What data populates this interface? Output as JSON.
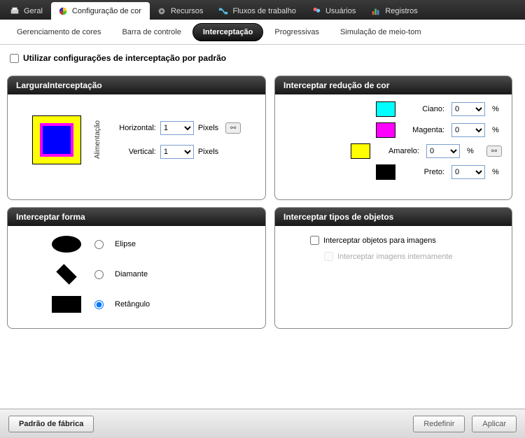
{
  "tabs": {
    "general": "Geral",
    "color": "Configuração de cor",
    "resources": "Recursos",
    "workflows": "Fluxos de trabalho",
    "users": "Usuários",
    "logs": "Registros",
    "active": "color"
  },
  "subtabs": {
    "items": [
      "Gerenciamento de cores",
      "Barra de controle",
      "Interceptação",
      "Progressivas",
      "Simulação de meio-tom"
    ],
    "active_index": 2
  },
  "checkbox_default": {
    "label": "Utilizar configurações de interceptação por padrão",
    "checked": false
  },
  "trap_width": {
    "title": "LarguraInterceptação",
    "feed_label": "Alimentação",
    "horizontal_label": "Horizontal:",
    "vertical_label": "Vertical:",
    "unit": "Pixels",
    "horizontal_value": "1",
    "vertical_value": "1"
  },
  "color_reduction": {
    "title": "Interceptar redução de cor",
    "rows": [
      {
        "label": "Ciano:",
        "swatch": "#00ffff",
        "value": "0",
        "unit": "%"
      },
      {
        "label": "Magenta:",
        "swatch": "#ff00ff",
        "value": "0",
        "unit": "%"
      },
      {
        "label": "Amarelo:",
        "swatch": "#ffff00",
        "value": "0",
        "unit": "%"
      },
      {
        "label": "Preto:",
        "swatch": "#000000",
        "value": "0",
        "unit": "%"
      }
    ]
  },
  "trap_shape": {
    "title": "Interceptar forma",
    "options": {
      "ellipse": "Elipse",
      "diamond": "Diamante",
      "rectangle": "Retângulo"
    },
    "selected": "rectangle"
  },
  "obj_types": {
    "title": "Interceptar tipos de objetos",
    "opt_images": {
      "label": "Interceptar objetos para imagens",
      "checked": false
    },
    "opt_internal": {
      "label": "Interceptar imagens internamente",
      "checked": false,
      "disabled": true
    }
  },
  "footer": {
    "factory": "Padrão de fábrica",
    "reset": "Redefinir",
    "apply": "Aplicar"
  }
}
